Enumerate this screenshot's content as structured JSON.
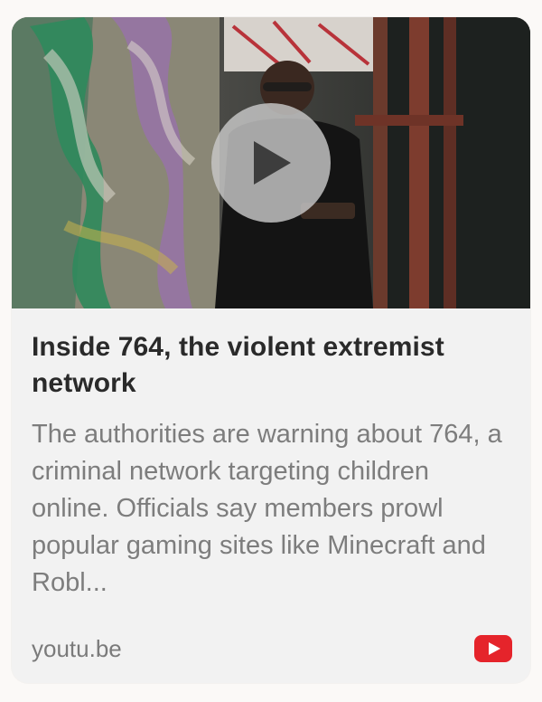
{
  "card": {
    "title": "Inside 764, the violent extremist network",
    "description": "The authorities are warning about 764, a criminal network targeting children online. Officials say members prowl popular gaming sites like Minecraft and Robl...",
    "source_domain": "youtu.be",
    "thumbnail_alt": "",
    "play_icon": "play-icon",
    "source_icon": "youtube-icon"
  },
  "colors": {
    "card_background": "#f2f2f2",
    "title": "#2a2a2a",
    "description": "#7d7d7d",
    "youtube_red": "#e5242b"
  }
}
